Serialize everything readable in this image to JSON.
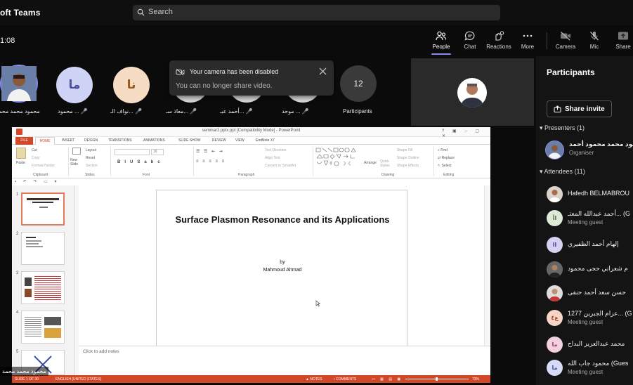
{
  "app": {
    "title": "oft Teams"
  },
  "search": {
    "label": "Search"
  },
  "meeting": {
    "timer": "1:08"
  },
  "toolbar": {
    "people": "People",
    "chat": "Chat",
    "reactions": "Reactions",
    "more": "More",
    "camera": "Camera",
    "mic": "Mic",
    "share": "Share"
  },
  "gallery": [
    {
      "name": "محمود محمد محمد",
      "initials": "",
      "bg": "#3b5fa0"
    },
    {
      "name": "محمود ...",
      "initials": "ما",
      "bg": "#cfd3f6",
      "fg": "#4a4f9c"
    },
    {
      "name": "نواف الـ...",
      "initials": "نا",
      "bg": "#f6dcc2",
      "fg": "#9a5b24"
    },
    {
      "name": "معاذ سـ...",
      "initials": "",
      "bg": "#d8d8d8"
    },
    {
      "name": "أحمد عبـ...",
      "initials": "",
      "bg": "#d8d8d8"
    },
    {
      "name": "موحد ...",
      "initials": "",
      "bg": "#d8d8d8"
    }
  ],
  "participants_tile": {
    "count": "12",
    "label": "Participants"
  },
  "toast": {
    "title": "Your camera has been disabled",
    "body": "You can no longer share video."
  },
  "panel": {
    "title": "Participants",
    "share_invite": "Share invite",
    "presenters_header": "Presenters (1)",
    "attendees_header": "Attendees (11)",
    "presenters": [
      {
        "name": "مود محمد محمود أحمد",
        "sub": "Organiser"
      }
    ],
    "attendees": [
      {
        "name": "Hafedh BELMABROU",
        "sub": "",
        "initials": "",
        "bg": "#c9a27c"
      },
      {
        "name": "أحمد عبدالله المعتـ... (G",
        "sub": "Meeting guest",
        "initials": "اأ",
        "bg": "#dfe9d8",
        "fg": "#4d6b3a"
      },
      {
        "name": "إلهام أحمد الظفيري",
        "sub": "",
        "initials": "اا",
        "bg": "#d6d0f3",
        "fg": "#4b3c99"
      },
      {
        "name": "م شعراني حجى محمود",
        "sub": "",
        "initials": "",
        "bg": "#7a7a7a"
      },
      {
        "name": "حسن سعد أحمد حنفى",
        "sub": "",
        "initials": "",
        "bg": "#c44"
      },
      {
        "name": "عزام الجبرين 1277... (G",
        "sub": "Meeting guest",
        "initials": "ع٤",
        "bg": "#f6d5c7",
        "fg": "#a2472b"
      },
      {
        "name": "محمد عبدالعزيز البداح",
        "sub": "",
        "initials": "ما",
        "bg": "#f2d0dd",
        "fg": "#97345a"
      },
      {
        "name": "محمود جاب الله (Gues",
        "sub": "Meeting guest",
        "initials": "ما",
        "bg": "#d6dbf6",
        "fg": "#3f4a9c"
      }
    ]
  },
  "ppt": {
    "window_title": "seminar2.pptx.ppt [Compatibility Mode] - PowerPoint",
    "tabs": [
      "FILE",
      "HOME",
      "INSERT",
      "DESIGN",
      "TRANSITIONS",
      "ANIMATIONS",
      "SLIDE SHOW",
      "REVIEW",
      "VIEW",
      "EndNote X7"
    ],
    "groups": {
      "clipboard": "Clipboard",
      "slides": "Slides",
      "font": "Font",
      "paragraph": "Paragraph",
      "drawing": "Drawing",
      "editing": "Editing"
    },
    "ribbon": {
      "paste": "Paste",
      "cut": "Cut",
      "copy": "Copy",
      "format_painter": "Format Painter",
      "new_slide": "New Slide",
      "layout": "Layout",
      "reset": "Reset",
      "section": "Section",
      "text_direction": "Text Direction",
      "align_text": "Align Text",
      "convert_smartart": "Convert to SmartArt",
      "arrange": "Arrange",
      "quick_styles": "Quick Styles",
      "shape_fill": "Shape Fill",
      "shape_outline": "Shape Outline",
      "shape_effects": "Shape Effects",
      "find": "Find",
      "replace": "Replace",
      "select": "Select",
      "font_size": "18"
    },
    "slide": {
      "title": "Surface Plasmon Resonance and its Applications",
      "by": "by",
      "author": "Mahmoud Ahmad"
    },
    "thumb_numbers": [
      "1",
      "2",
      "3",
      "4",
      "5"
    ],
    "notes_placeholder": "Click to add notes",
    "status": {
      "slide_info": "SLIDE 1 OF 30",
      "language": "ENGLISH (UNITED STATES)",
      "notes": "NOTES",
      "comments": "COMMENTS",
      "zoom": "73%"
    }
  },
  "self_label": "محمود محمد محمد"
}
